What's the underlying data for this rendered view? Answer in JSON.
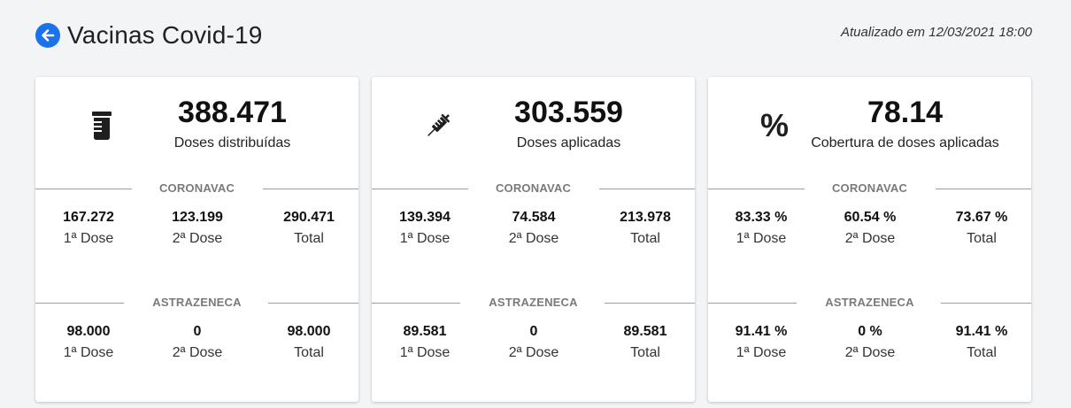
{
  "header": {
    "title": "Vacinas Covid-19",
    "updated": "Atualizado em 12/03/2021 18:00"
  },
  "cards": [
    {
      "icon": "vaccine-vial-icon",
      "value": "388.471",
      "label": "Doses distribuídas",
      "sections": [
        {
          "name": "CORONAVAC",
          "stats": [
            {
              "value": "167.272",
              "label": "1ª Dose"
            },
            {
              "value": "123.199",
              "label": "2ª Dose"
            },
            {
              "value": "290.471",
              "label": "Total"
            }
          ]
        },
        {
          "name": "ASTRAZENECA",
          "stats": [
            {
              "value": "98.000",
              "label": "1ª Dose"
            },
            {
              "value": "0",
              "label": "2ª Dose"
            },
            {
              "value": "98.000",
              "label": "Total"
            }
          ]
        }
      ]
    },
    {
      "icon": "syringe-icon",
      "value": "303.559",
      "label": "Doses aplicadas",
      "sections": [
        {
          "name": "CORONAVAC",
          "stats": [
            {
              "value": "139.394",
              "label": "1ª Dose"
            },
            {
              "value": "74.584",
              "label": "2ª Dose"
            },
            {
              "value": "213.978",
              "label": "Total"
            }
          ]
        },
        {
          "name": "ASTRAZENECA",
          "stats": [
            {
              "value": "89.581",
              "label": "1ª Dose"
            },
            {
              "value": "0",
              "label": "2ª Dose"
            },
            {
              "value": "89.581",
              "label": "Total"
            }
          ]
        }
      ]
    },
    {
      "icon": "percent-icon",
      "icon_glyph": "%",
      "value": "78.14",
      "label": "Cobertura de doses aplicadas",
      "sections": [
        {
          "name": "CORONAVAC",
          "stats": [
            {
              "value": "83.33 %",
              "label": "1ª Dose"
            },
            {
              "value": "60.54 %",
              "label": "2ª Dose"
            },
            {
              "value": "73.67 %",
              "label": "Total"
            }
          ]
        },
        {
          "name": "ASTRAZENECA",
          "stats": [
            {
              "value": "91.41 %",
              "label": "1ª Dose"
            },
            {
              "value": "0 %",
              "label": "2ª Dose"
            },
            {
              "value": "91.41 %",
              "label": "Total"
            }
          ]
        }
      ]
    }
  ],
  "colors": {
    "accent": "#1a73e8",
    "background": "#f3f4f6",
    "divider": "#9e9e9e"
  }
}
